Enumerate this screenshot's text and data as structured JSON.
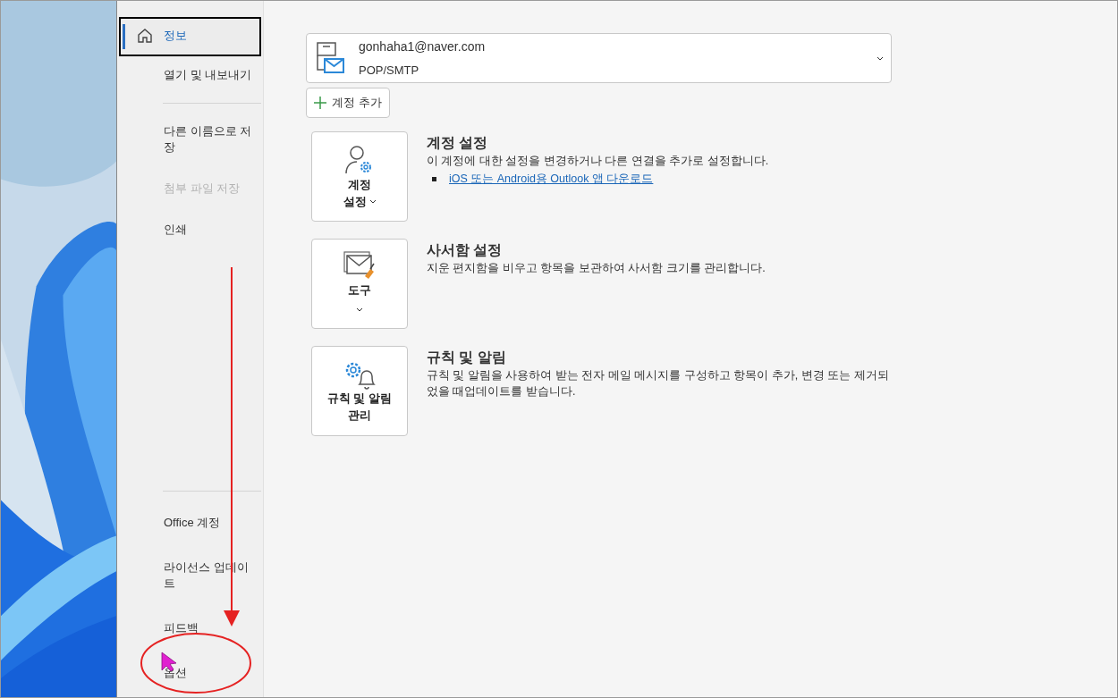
{
  "sidebar": {
    "groups": [
      {
        "items": [
          {
            "label": "정보",
            "kind": "home",
            "selected": true,
            "disabled": false
          },
          {
            "label": "열기 및 내보내기",
            "kind": "plain",
            "selected": false,
            "disabled": false
          }
        ]
      },
      {
        "items": [
          {
            "label": "다른 이름으로 저장",
            "kind": "plain",
            "selected": false,
            "disabled": false
          },
          {
            "label": "첨부 파일 저장",
            "kind": "plain",
            "selected": false,
            "disabled": true
          },
          {
            "label": "인쇄",
            "kind": "plain",
            "selected": false,
            "disabled": false
          }
        ]
      },
      {
        "items": [
          {
            "label": "Office 계정",
            "kind": "plain",
            "selected": false,
            "disabled": false
          },
          {
            "label": "라이선스 업데이트",
            "kind": "plain",
            "selected": false,
            "disabled": false
          },
          {
            "label": "피드백",
            "kind": "plain",
            "selected": false,
            "disabled": false
          },
          {
            "label": "옵션",
            "kind": "plain",
            "selected": false,
            "disabled": false
          }
        ]
      }
    ]
  },
  "account": {
    "email": "gonhaha1@naver.com",
    "type": "POP/SMTP"
  },
  "add_account_button": "계정 추가",
  "sections": [
    {
      "kind": "account",
      "button_lines": [
        "계정",
        "설정"
      ],
      "dropdown": true,
      "title": "계정 설정",
      "description": "이 계정에 대한 설정을 변경하거나 다른 연결을 추가로 설정합니다.",
      "link": "iOS 또는 Android용 Outlook 앱 다운로드"
    },
    {
      "kind": "tools",
      "button_lines": [
        "도구"
      ],
      "dropdown": true,
      "title": "사서함 설정",
      "description": "지운 편지함을 비우고 항목을 보관하여 사서함 크기를 관리합니다."
    },
    {
      "kind": "rules",
      "button_lines": [
        "규칙 및 알림",
        "관리"
      ],
      "dropdown": false,
      "title": "규칙 및 알림",
      "description": "규칙 및 알림을 사용하여 받는 전자 메일 메시지를 구성하고 항목이 추가, 변경 또는 제거되었을 때업데이트를 받습니다."
    }
  ]
}
